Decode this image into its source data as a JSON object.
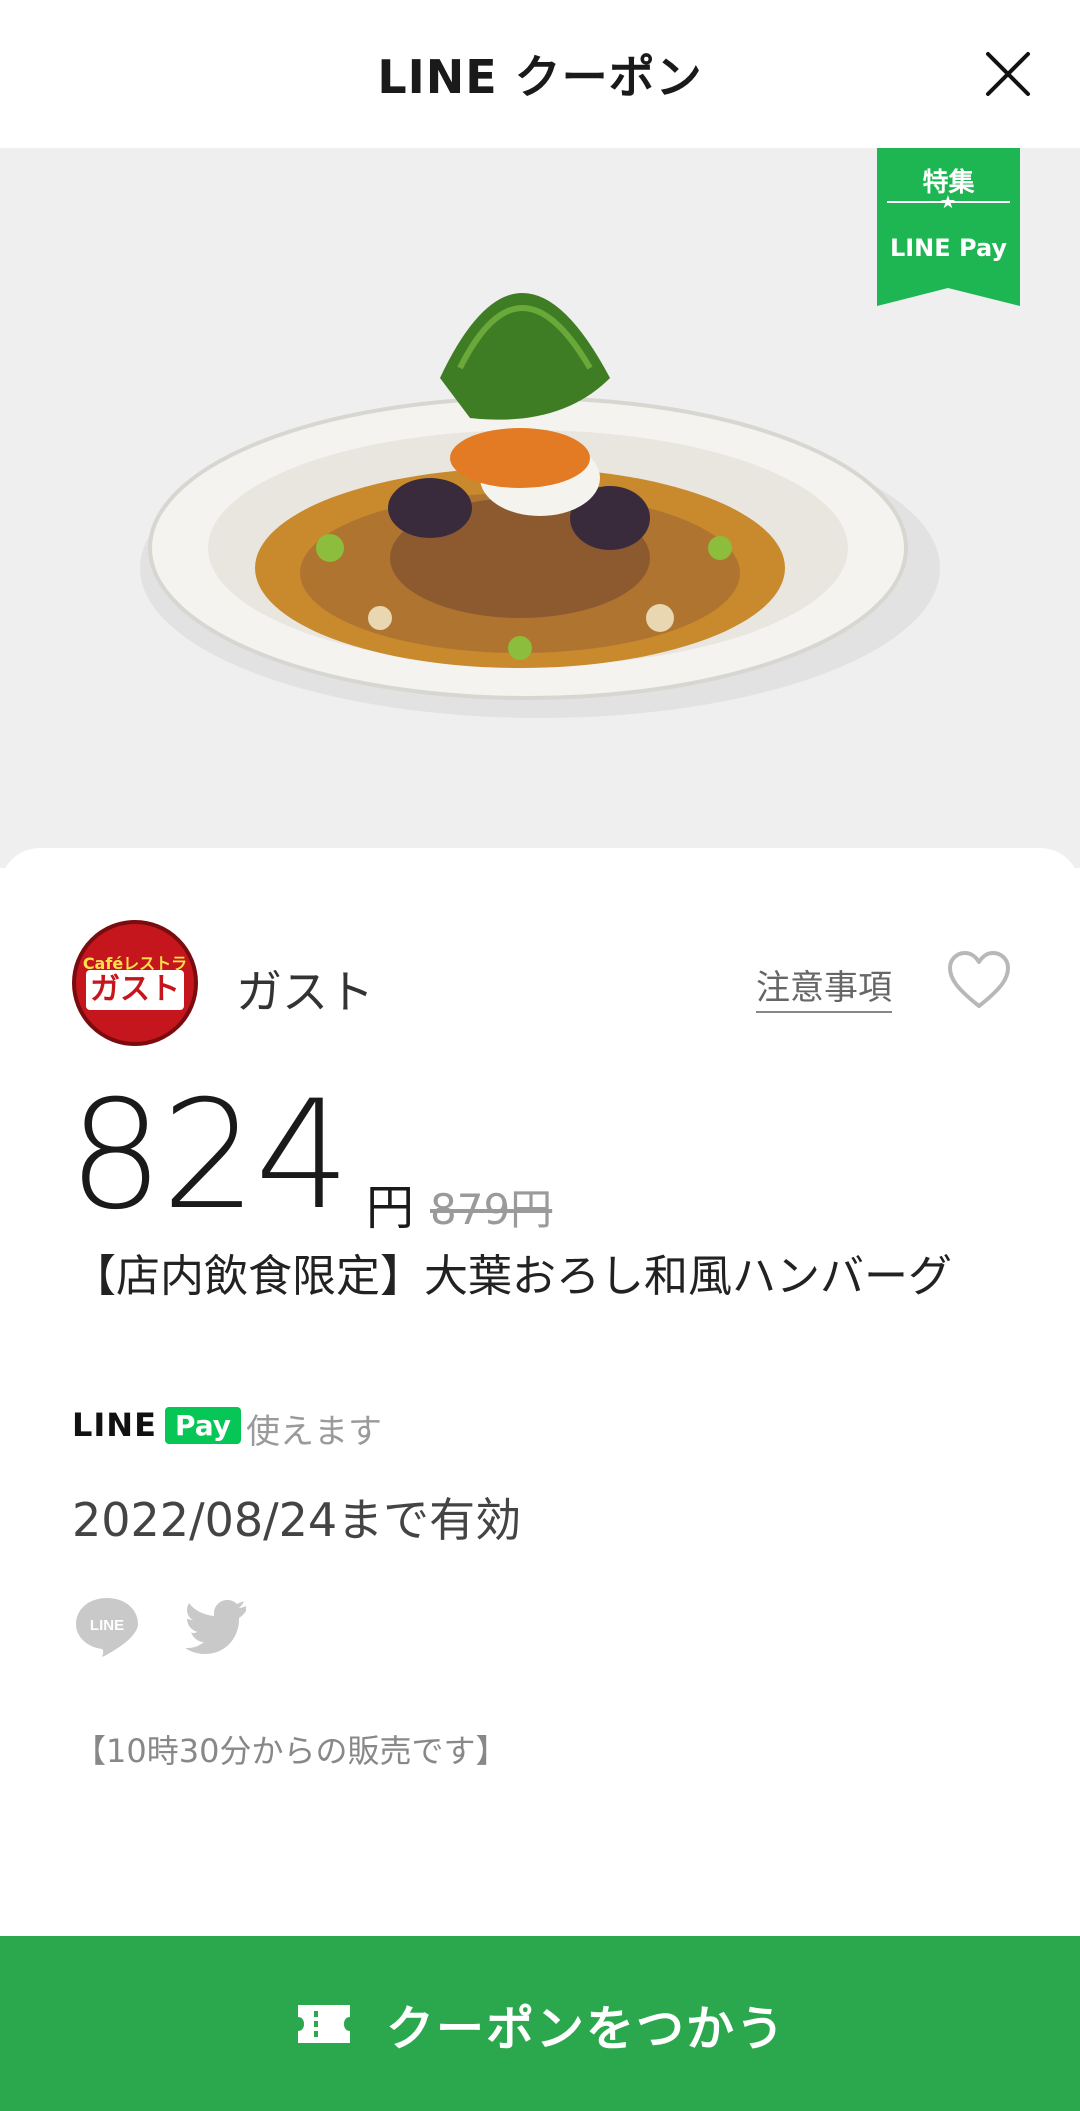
{
  "header": {
    "title": "LINE クーポン",
    "close_icon": "close-icon"
  },
  "hero": {
    "ribbon_top": "特集",
    "ribbon_bottom": "LINE Pay"
  },
  "brand": {
    "logo_small": "Caféレストラン",
    "logo_main": "ガスト",
    "name": "ガスト",
    "notes_link": "注意事項",
    "favorite_icon": "heart-icon"
  },
  "price": {
    "value": "824",
    "unit": "円",
    "original": "879円"
  },
  "coupon": {
    "title": "【店内飲食限定】大葉おろし和風ハンバーグ",
    "pay_line": "LINE",
    "pay_pay": "Pay",
    "pay_text": "使えます",
    "valid_until": "2022/08/24まで有効",
    "note": "【10時30分からの販売です】"
  },
  "share": {
    "line_icon": "line-share-icon",
    "twitter_icon": "twitter-share-icon"
  },
  "cta": {
    "label": "クーポンをつかう",
    "icon": "ticket-icon"
  },
  "colors": {
    "accent_green": "#2ba84d",
    "line_green": "#06c755",
    "brand_red": "#c4161c"
  }
}
